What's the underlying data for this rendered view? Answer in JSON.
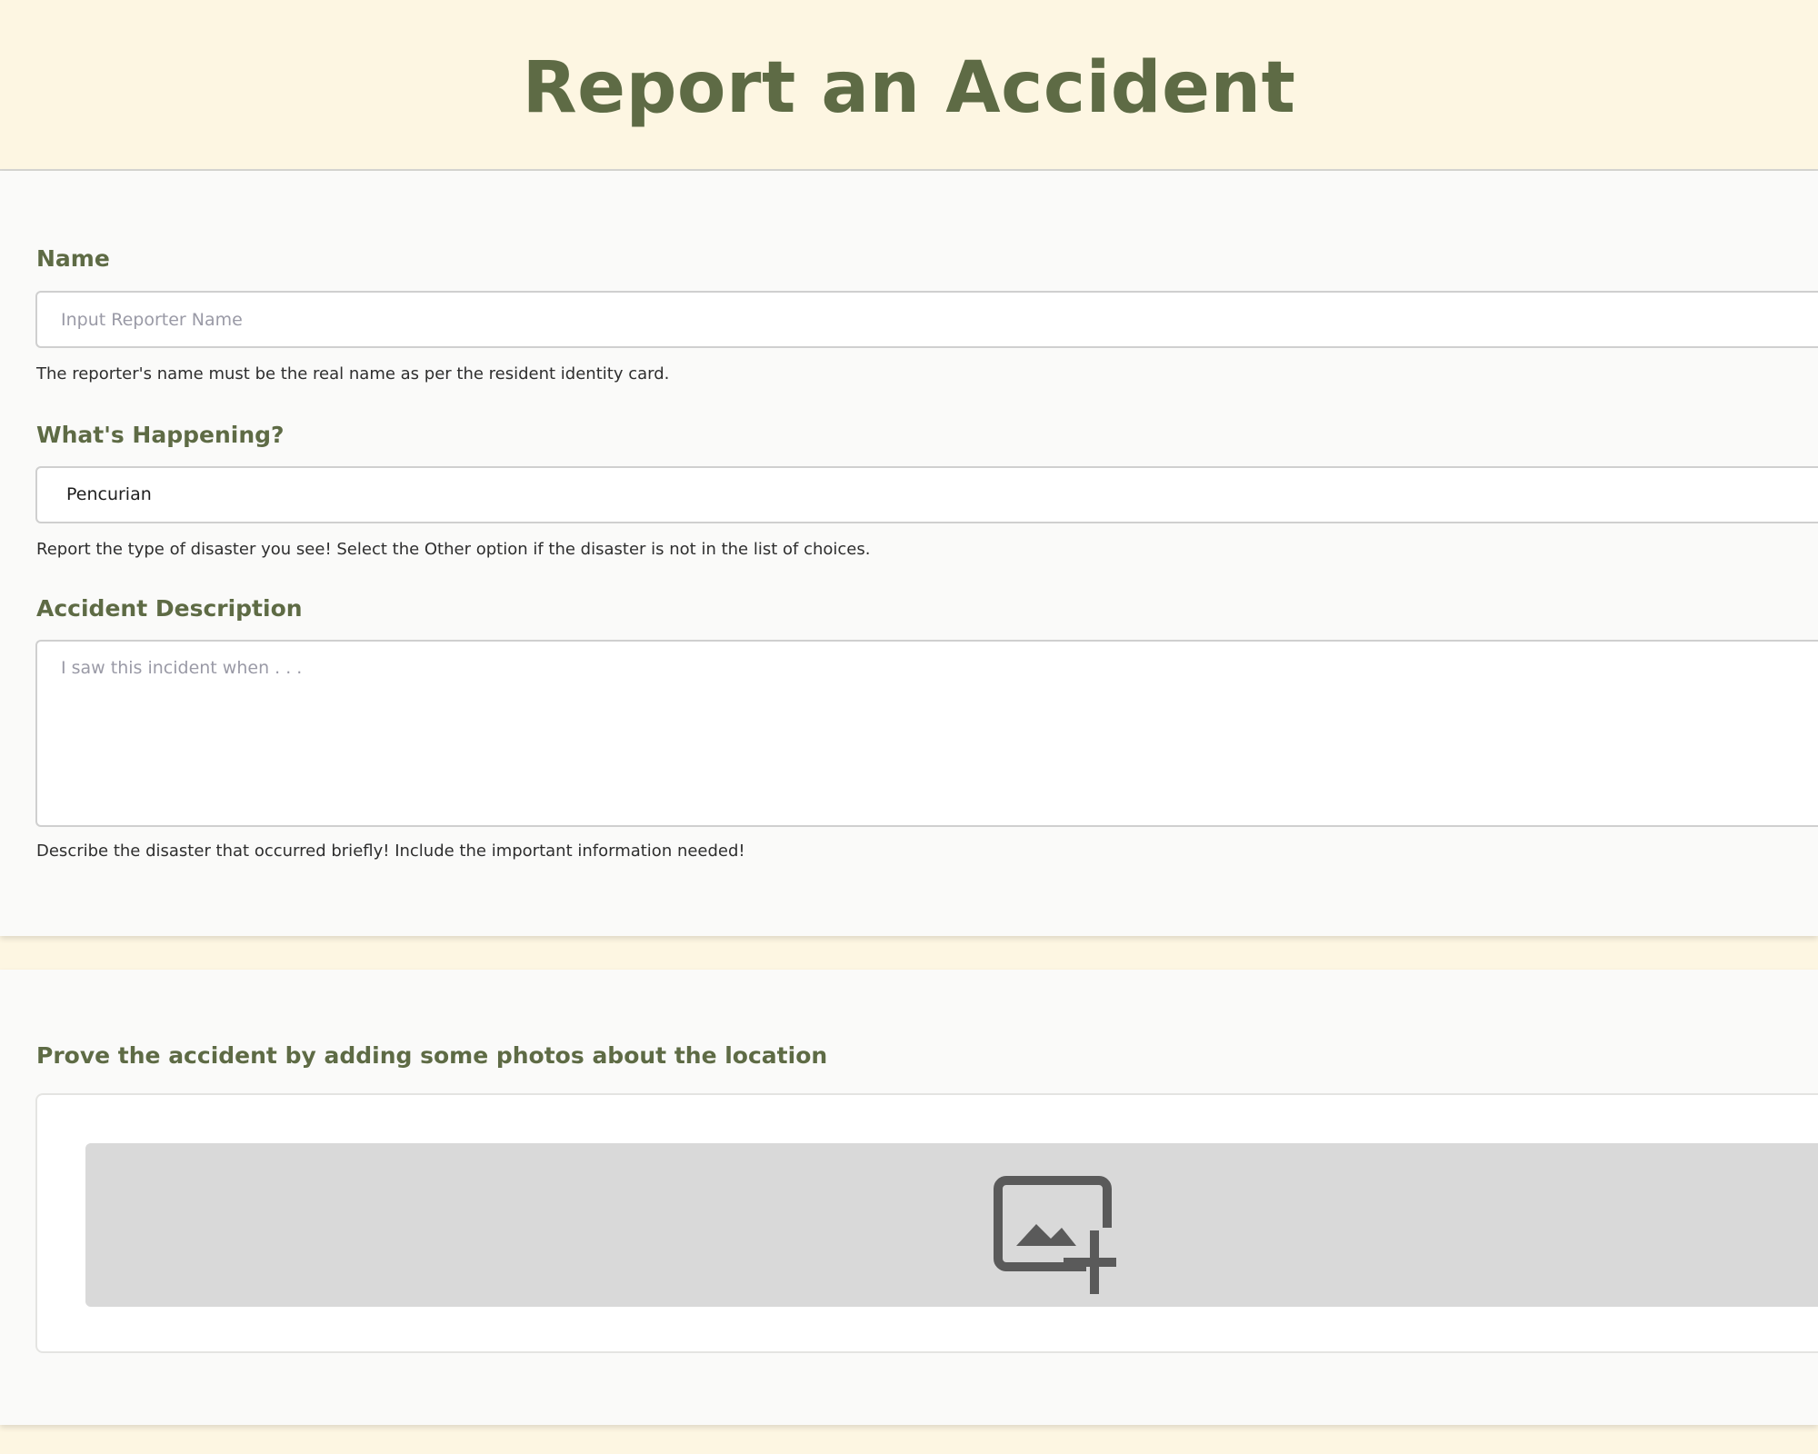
{
  "header": {
    "title": "Report an Accident"
  },
  "form": {
    "name": {
      "label": "Name",
      "placeholder": "Input Reporter Name",
      "value": "",
      "help": "The reporter's name must be the real name as per the resident identity card."
    },
    "happening": {
      "label": "What's Happening?",
      "selected": "Pencurian",
      "help": "Report the type of disaster you see! Select the Other option if the disaster is not in the list of choices."
    },
    "description": {
      "label": "Accident Description",
      "placeholder": "I saw this incident when . . .",
      "value": "",
      "help": "Describe the disaster that occurred briefly! Include the important information needed!"
    }
  },
  "photos": {
    "label": "Prove the accident by adding some photos about the location",
    "upload_icon": "add-photo-icon"
  },
  "colors": {
    "accent": "#5e6b45",
    "background": "#fdf6e2",
    "card": "#fafaf9",
    "upload_area": "#d9d9d9",
    "icon": "#5a5a5a"
  }
}
